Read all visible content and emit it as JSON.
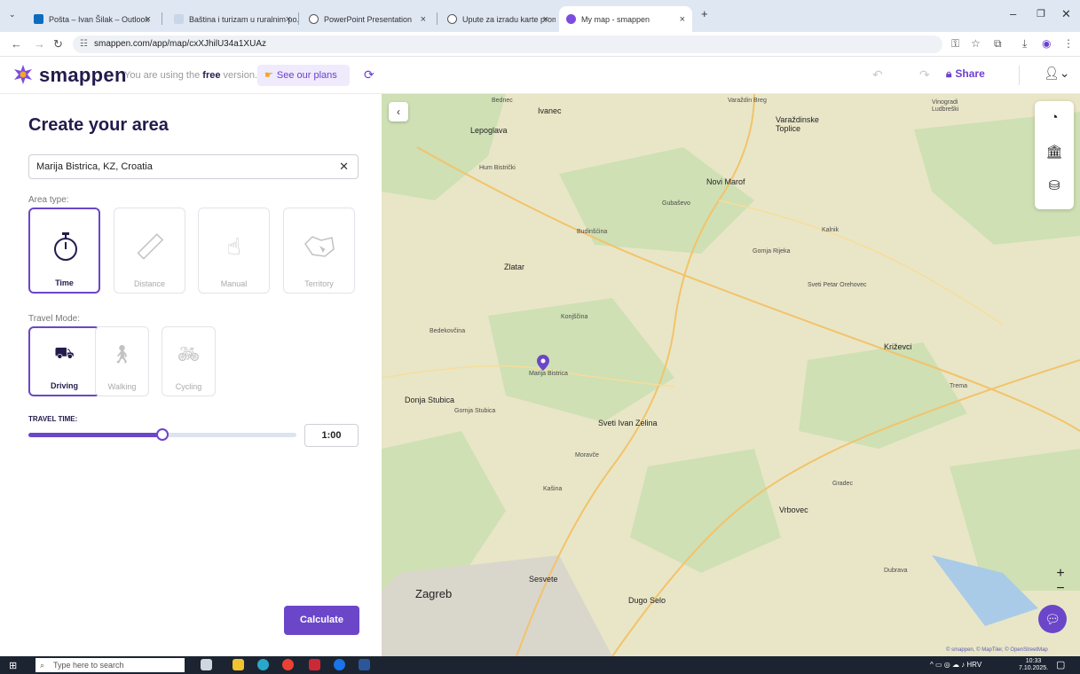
{
  "browser": {
    "tabs": [
      {
        "label": "Pošta – Ivan Šilak – Outlook",
        "color": "#0f6cbd"
      },
      {
        "label": "Baština i turizam u ruralnim po...",
        "color": "#c8d6ea"
      },
      {
        "label": "PowerPoint Presentation",
        "color": "#555555"
      },
      {
        "label": "Upute za izradu karte prometn...",
        "color": "#555555"
      },
      {
        "label": "My map - smappen",
        "color": "#7c4ce0"
      }
    ],
    "url": "smappen.com/app/map/cxXJhilU34a1XUAz"
  },
  "header": {
    "logo": "smappen",
    "free_prefix": "You are using the ",
    "free_word": "free",
    "free_suffix": " version.",
    "plans_label": "See our plans",
    "share_label": "Share"
  },
  "panel": {
    "title": "Create your area",
    "location": "Marija Bistrica, KZ, Croatia",
    "area_type_label": "Area type:",
    "area_types": [
      {
        "label": "Time",
        "icon": "stopwatch-icon",
        "selected": true
      },
      {
        "label": "Distance",
        "icon": "ruler-icon",
        "selected": false
      },
      {
        "label": "Manual",
        "icon": "hand-pointer-icon",
        "selected": false
      },
      {
        "label": "Territory",
        "icon": "territory-icon",
        "selected": false
      }
    ],
    "travel_mode_label": "Travel Mode:",
    "travel_modes": [
      {
        "label": "Driving",
        "icon": "car-icon",
        "selected": true
      },
      {
        "label": "Walking",
        "icon": "walking-icon",
        "selected": false
      },
      {
        "label": "Cycling",
        "icon": "bicycle-icon",
        "selected": false
      }
    ],
    "travel_time_label": "TRAVEL TIME:",
    "travel_time_value": "1:00",
    "slider_fraction": 0.5,
    "calculate_label": "Calculate"
  },
  "map": {
    "labels": [
      {
        "t": "Bednec",
        "c": "s"
      },
      {
        "t": "Ivanec",
        "c": "b"
      },
      {
        "t": "Lepoglava",
        "c": "b"
      },
      {
        "t": "Varaždin Breg",
        "c": "s"
      },
      {
        "t": "Varaždinske Toplice",
        "c": "b"
      },
      {
        "t": "Novi Marof",
        "c": "b"
      },
      {
        "t": "Zlatar",
        "c": "b"
      },
      {
        "t": "Marija Bistrica",
        "c": "s"
      },
      {
        "t": "Donja Stubica",
        "c": "b"
      },
      {
        "t": "Sveti Ivan Zelina",
        "c": "b"
      },
      {
        "t": "Vrbovec",
        "c": "b"
      },
      {
        "t": "Križevci",
        "c": "b"
      },
      {
        "t": "Zagreb",
        "c": "c"
      },
      {
        "t": "Dugo Selo",
        "c": "b"
      },
      {
        "t": "Sesvete",
        "c": "b"
      },
      {
        "t": "Konjščina",
        "c": "s"
      },
      {
        "t": "Budinšćina",
        "c": "s"
      },
      {
        "t": "Gornja Rijeka",
        "c": "s"
      },
      {
        "t": "Kalnik",
        "c": "s"
      },
      {
        "t": "Sveti Petar Orehovec",
        "c": "s"
      },
      {
        "t": "Bedekovčina",
        "c": "s"
      },
      {
        "t": "Gornja Stubica",
        "c": "s"
      },
      {
        "t": "Moravče",
        "c": "s"
      },
      {
        "t": "Kašina",
        "c": "s"
      },
      {
        "t": "Gradec",
        "c": "s"
      },
      {
        "t": "Dubrava",
        "c": "s"
      },
      {
        "t": "Vinogradi Ludbreški",
        "c": "s"
      },
      {
        "t": "Trema",
        "c": "s"
      },
      {
        "t": "Hum Bistrički",
        "c": "s"
      },
      {
        "t": "Gubaševo",
        "c": "s"
      }
    ],
    "attribution": "© smappen, © MapTiler, © OpenStreetMap"
  },
  "taskbar": {
    "search_placeholder": "Type here to search",
    "lang": "HRV",
    "time": "10:33",
    "date": "7.10.2025."
  }
}
